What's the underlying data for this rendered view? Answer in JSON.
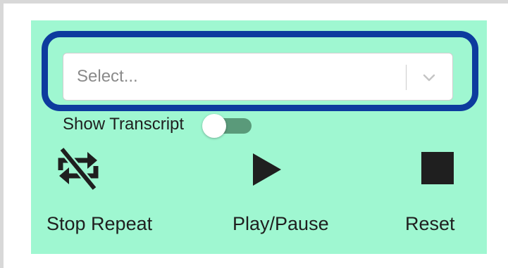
{
  "select": {
    "placeholder": "Select...",
    "dropdown_icon": "chevron-down-icon"
  },
  "transcript_toggle": {
    "label": "Show Transcript",
    "state": "off"
  },
  "controls": {
    "stop_repeat": {
      "label": "Stop Repeat",
      "icon": "repeat-off-icon"
    },
    "play_pause": {
      "label": "Play/Pause",
      "icon": "play-icon"
    },
    "reset": {
      "label": "Reset",
      "icon": "stop-icon"
    }
  },
  "colors": {
    "panel_background": "#9ff7d1",
    "focus_ring": "#0d3b9e",
    "toggle_track": "#5a9a7a",
    "icon_color": "#1f1f1f"
  }
}
